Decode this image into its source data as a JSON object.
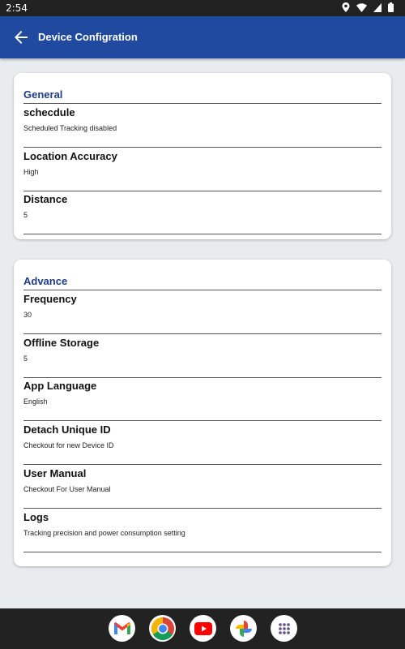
{
  "status_bar": {
    "time": "2:54"
  },
  "app_bar": {
    "title": "Device Configration"
  },
  "general": {
    "heading": "General",
    "items": [
      {
        "title": "schecdule",
        "subtitle": "Scheduled Tracking disabled"
      },
      {
        "title": "Location Accuracy",
        "subtitle": "High"
      },
      {
        "title": "Distance",
        "subtitle": "5"
      }
    ]
  },
  "advance": {
    "heading": "Advance",
    "items": [
      {
        "title": "Frequency",
        "subtitle": "30"
      },
      {
        "title": "Offline Storage",
        "subtitle": "5"
      },
      {
        "title": "App Language",
        "subtitle": "English"
      },
      {
        "title": "Detach Unique ID",
        "subtitle": "Checkout for new Device ID"
      },
      {
        "title": "User Manual",
        "subtitle": "Checkout For User Manual"
      },
      {
        "title": "Logs",
        "subtitle": "Tracking precision and power consumption setting"
      }
    ]
  },
  "dock_apps": [
    "gmail-icon",
    "chrome-icon",
    "youtube-icon",
    "photos-icon",
    "app-drawer-icon"
  ],
  "colors": {
    "app_bar": "#1f4aa0",
    "section_heading": "#1f3c88",
    "background": "#e8ecef"
  }
}
